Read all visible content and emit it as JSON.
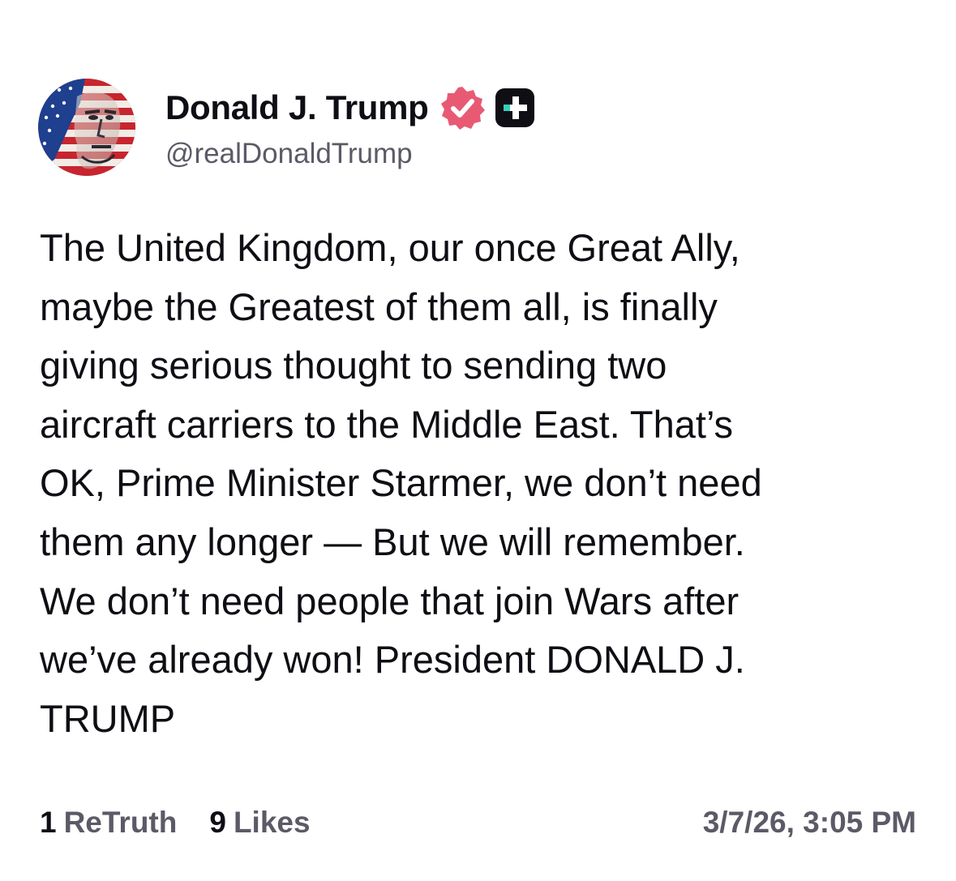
{
  "author": {
    "display_name": "Donald J. Trump",
    "handle": "@realDonaldTrump",
    "verified_icon": "verified-badge-icon",
    "plus_icon": "plus-badge-icon",
    "colors": {
      "verified": "#e85a74",
      "plus_badge": "#0f0e14",
      "plus_accent": "#35d0ba"
    }
  },
  "post": {
    "text": "The United Kingdom, our once Great Ally,\nmaybe the Greatest of them all, is finally\ngiving serious thought to sending two\naircraft carriers to the Middle East. That’s\nOK, Prime Minister Starmer, we don’t need\nthem any longer — But we will remember.\nWe don’t need people that join Wars after\nwe’ve already won! President DONALD J.\nTRUMP"
  },
  "stats": {
    "retruths_count": "1",
    "retruths_label": "ReTruth",
    "likes_count": "9",
    "likes_label": "Likes"
  },
  "timestamp": "3/7/26, 3:05 PM",
  "colors": {
    "text_primary": "#0f0e14",
    "text_secondary": "#5b5a66",
    "background": "#ffffff"
  }
}
